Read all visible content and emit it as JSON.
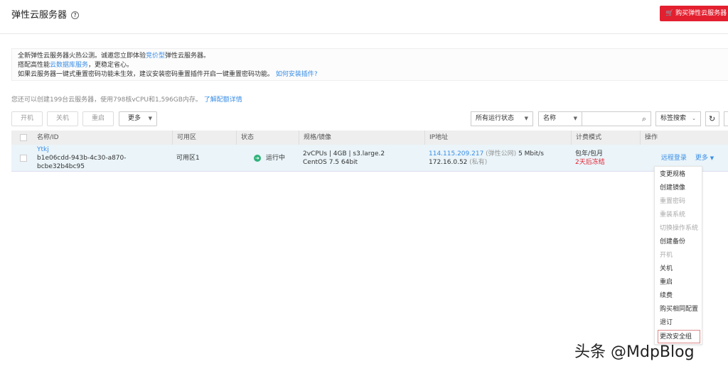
{
  "header": {
    "title": "弹性云服务器",
    "help_icon": "?",
    "buy_label": "购买弹性云服务器"
  },
  "notice": {
    "line1_pre": "全新弹性云服务器火热公测。诚邀您立即体验",
    "line1_link": "竞价型",
    "line1_post": "弹性云服务器。",
    "line2_pre": "搭配高性能",
    "line2_link": "云数据库服务",
    "line2_post": "，更稳定省心。",
    "line3_pre": "如果云服务器一键式重置密码功能未生效，建议安装密码重置插件开启一键重置密码功能。",
    "line3_link": "如何安装插件?"
  },
  "quota": {
    "text": "您还可以创建199台云服务器，使用798核vCPU和1,596GB内存。",
    "link": "了解配额详情"
  },
  "toolbar": {
    "start": "开机",
    "stop": "关机",
    "restart": "重启",
    "more": "更多",
    "status_filter": "所有运行状态",
    "search_field": "名称",
    "search_value": "",
    "tag_search": "标签搜索"
  },
  "table": {
    "headers": [
      "名称/ID",
      "可用区",
      "状态",
      "规格/镜像",
      "IP地址",
      "计费模式",
      "操作"
    ],
    "row": {
      "name": "Ytkj",
      "id": "b1e06cdd-943b-4c30-a870-bcbe32b4bc95",
      "zone": "可用区1",
      "status": "运行中",
      "spec": "2vCPUs | 4GB | s3.large.2",
      "image": "CentOS 7.5 64bit",
      "public_ip": "114.115.209.217",
      "public_ip_tag": "(弹性公网)",
      "bandwidth": "5 Mbit/s",
      "private_ip": "172.16.0.52",
      "private_ip_tag": "(私有)",
      "billing": "包年/包月",
      "billing_note": "2天后冻结",
      "remote_login": "远程登录",
      "more": "更多"
    }
  },
  "menu": [
    {
      "label": "变更规格",
      "disabled": false
    },
    {
      "label": "创建镜像",
      "disabled": false
    },
    {
      "label": "重置密码",
      "disabled": true
    },
    {
      "label": "重装系统",
      "disabled": true
    },
    {
      "label": "切换操作系统",
      "disabled": true
    },
    {
      "label": "创建备份",
      "disabled": false
    },
    {
      "label": "开机",
      "disabled": true
    },
    {
      "label": "关机",
      "disabled": false
    },
    {
      "label": "重启",
      "disabled": false
    },
    {
      "label": "续费",
      "disabled": false
    },
    {
      "label": "购买相同配置",
      "disabled": false
    },
    {
      "label": "退订",
      "disabled": false
    },
    {
      "label": "更改安全组",
      "disabled": false
    }
  ],
  "watermark": "头条 @MdpBlog"
}
